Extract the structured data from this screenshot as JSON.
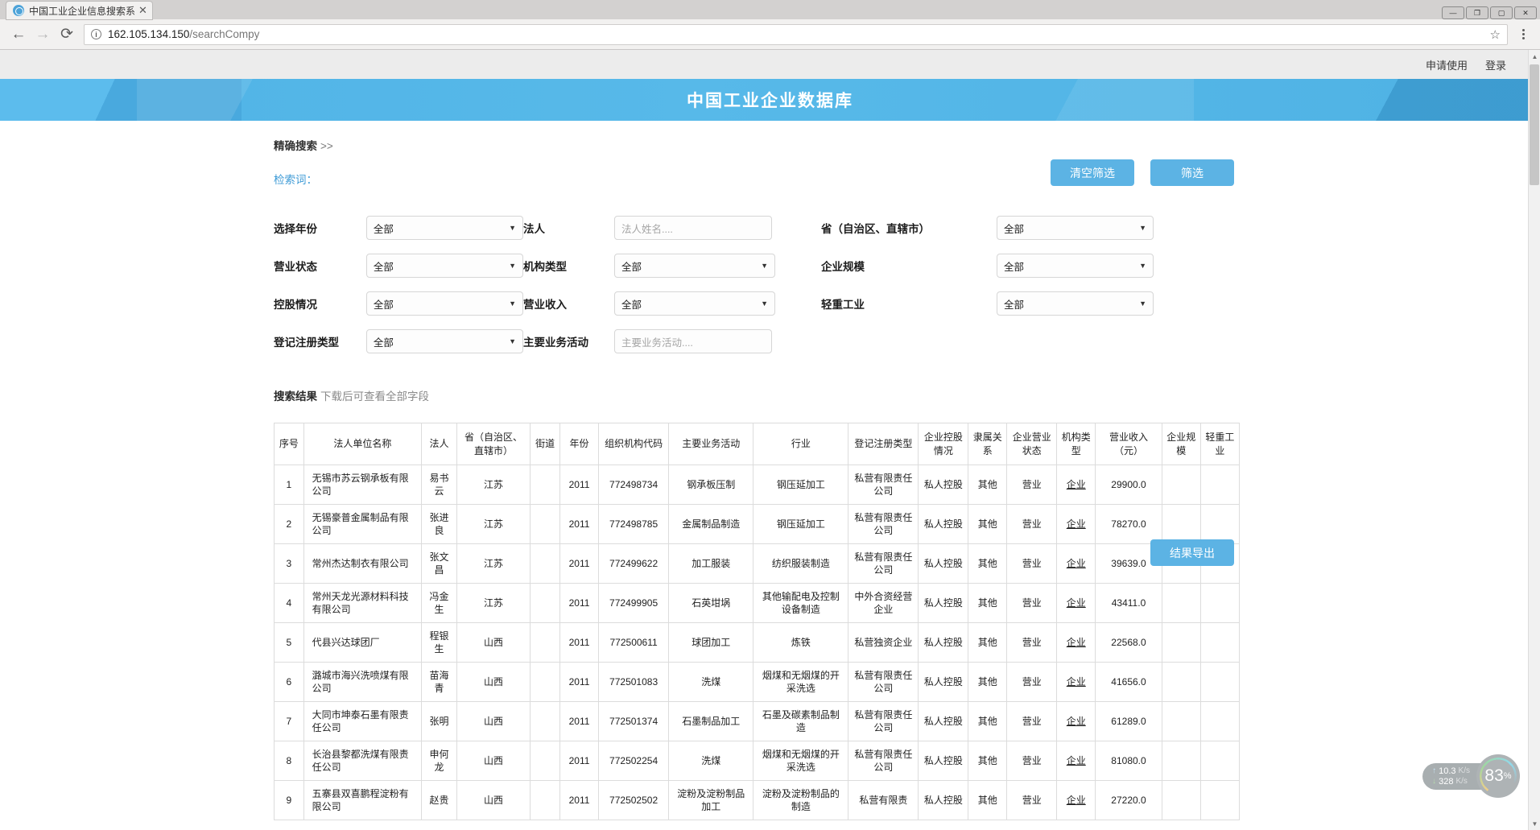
{
  "browser": {
    "tab_title": "中国工业企业信息搜索系",
    "tab_close": "✕",
    "favicon": "globe-icon",
    "back": "←",
    "forward": "→",
    "reload": "⟳",
    "url_host": "162.105.134.150",
    "url_path": "/searchCompy",
    "star": "☆",
    "win_minimize": "—",
    "win_restore": "❐",
    "win_maximize": "▢",
    "win_close": "✕"
  },
  "topbar": {
    "apply": "申请使用",
    "login": "登录"
  },
  "banner": {
    "title": "中国工业企业数据库",
    "bg_color": "#50b3e6"
  },
  "search": {
    "precise_label": "精确搜索",
    "precise_arrows": ">>",
    "keyword_label": "检索词：",
    "clear_button": "清空筛选",
    "filter_button": "筛选",
    "accent_color": "#5cb3e4"
  },
  "filters": {
    "rows": [
      [
        {
          "label": "选择年份",
          "type": "select",
          "value": "全部"
        },
        {
          "label": "法人",
          "type": "text",
          "value": "",
          "placeholder": "法人姓名...."
        },
        {
          "label": "省（自治区、直辖市）",
          "type": "select",
          "value": "全部"
        }
      ],
      [
        {
          "label": "营业状态",
          "type": "select",
          "value": "全部"
        },
        {
          "label": "机构类型",
          "type": "select",
          "value": "全部"
        },
        {
          "label": "企业规模",
          "type": "select",
          "value": "全部"
        }
      ],
      [
        {
          "label": "控股情况",
          "type": "select",
          "value": "全部"
        },
        {
          "label": "营业收入",
          "type": "select",
          "value": "全部"
        },
        {
          "label": "轻重工业",
          "type": "select",
          "value": "全部"
        }
      ],
      [
        {
          "label": "登记注册类型",
          "type": "select",
          "value": "全部"
        },
        {
          "label": "主要业务活动",
          "type": "text",
          "value": "",
          "placeholder": "主要业务活动...."
        }
      ]
    ]
  },
  "results": {
    "title": "搜索结果",
    "hint": "下载后可查看全部字段",
    "export_button": "结果导出",
    "columns": [
      "序号",
      "法人单位名称",
      "法人",
      "省（自治区、直辖市）",
      "街道",
      "年份",
      "组织机构代码",
      "主要业务活动",
      "行业",
      "登记注册类型",
      "企业控股情况",
      "隶属关系",
      "企业营业状态",
      "机构类型",
      "营业收入（元）",
      "企业规模",
      "轻重工业"
    ],
    "rows": [
      {
        "no": "1",
        "name": "无锡市苏云钢承板有限公司",
        "legal": "易书云",
        "province": "江苏",
        "street": "",
        "year": "2011",
        "code": "772498734",
        "activity": "钢承板压制",
        "industry": "钢压延加工",
        "reg_type": "私营有限责任公司",
        "holding": "私人控股",
        "affiliation": "其他",
        "biz_status": "营业",
        "org_type": "企业",
        "revenue": "29900.0",
        "scale": "",
        "lh_industry": ""
      },
      {
        "no": "2",
        "name": "无锡豪普金属制品有限公司",
        "legal": "张进良",
        "province": "江苏",
        "street": "",
        "year": "2011",
        "code": "772498785",
        "activity": "金属制品制造",
        "industry": "钢压延加工",
        "reg_type": "私营有限责任公司",
        "holding": "私人控股",
        "affiliation": "其他",
        "biz_status": "营业",
        "org_type": "企业",
        "revenue": "78270.0",
        "scale": "",
        "lh_industry": ""
      },
      {
        "no": "3",
        "name": "常州杰达制衣有限公司",
        "legal": "张文昌",
        "province": "江苏",
        "street": "",
        "year": "2011",
        "code": "772499622",
        "activity": "加工服装",
        "industry": "纺织服装制造",
        "reg_type": "私营有限责任公司",
        "holding": "私人控股",
        "affiliation": "其他",
        "biz_status": "营业",
        "org_type": "企业",
        "revenue": "39639.0",
        "scale": "",
        "lh_industry": ""
      },
      {
        "no": "4",
        "name": "常州天龙光源材料科技有限公司",
        "legal": "冯金生",
        "province": "江苏",
        "street": "",
        "year": "2011",
        "code": "772499905",
        "activity": "石英坩埚",
        "industry": "其他输配电及控制设备制造",
        "reg_type": "中外合资经营企业",
        "holding": "私人控股",
        "affiliation": "其他",
        "biz_status": "营业",
        "org_type": "企业",
        "revenue": "43411.0",
        "scale": "",
        "lh_industry": ""
      },
      {
        "no": "5",
        "name": "代县兴达球团厂",
        "legal": "程银生",
        "province": "山西",
        "street": "",
        "year": "2011",
        "code": "772500611",
        "activity": "球团加工",
        "industry": "炼铁",
        "reg_type": "私营独资企业",
        "holding": "私人控股",
        "affiliation": "其他",
        "biz_status": "营业",
        "org_type": "企业",
        "revenue": "22568.0",
        "scale": "",
        "lh_industry": ""
      },
      {
        "no": "6",
        "name": "潞城市海兴洗喷煤有限公司",
        "legal": "苗海青",
        "province": "山西",
        "street": "",
        "year": "2011",
        "code": "772501083",
        "activity": "洗煤",
        "industry": "烟煤和无烟煤的开采洗选",
        "reg_type": "私营有限责任公司",
        "holding": "私人控股",
        "affiliation": "其他",
        "biz_status": "营业",
        "org_type": "企业",
        "revenue": "41656.0",
        "scale": "",
        "lh_industry": ""
      },
      {
        "no": "7",
        "name": "大同市坤泰石墨有限责任公司",
        "legal": "张明",
        "province": "山西",
        "street": "",
        "year": "2011",
        "code": "772501374",
        "activity": "石墨制品加工",
        "industry": "石墨及碳素制品制造",
        "reg_type": "私营有限责任公司",
        "holding": "私人控股",
        "affiliation": "其他",
        "biz_status": "营业",
        "org_type": "企业",
        "revenue": "61289.0",
        "scale": "",
        "lh_industry": ""
      },
      {
        "no": "8",
        "name": "长治县黎都洗煤有限责任公司",
        "legal": "申何龙",
        "province": "山西",
        "street": "",
        "year": "2011",
        "code": "772502254",
        "activity": "洗煤",
        "industry": "烟煤和无烟煤的开采洗选",
        "reg_type": "私营有限责任公司",
        "holding": "私人控股",
        "affiliation": "其他",
        "biz_status": "营业",
        "org_type": "企业",
        "revenue": "81080.0",
        "scale": "",
        "lh_industry": ""
      },
      {
        "no": "9",
        "name": "五寨县双喜鹏程淀粉有限公司",
        "legal": "赵贵",
        "province": "山西",
        "street": "",
        "year": "2011",
        "code": "772502502",
        "activity": "淀粉及淀粉制品加工",
        "industry": "淀粉及淀粉制品的制造",
        "reg_type": "私营有限责",
        "holding": "私人控股",
        "affiliation": "其他",
        "biz_status": "营业",
        "org_type": "企业",
        "revenue": "27220.0",
        "scale": "",
        "lh_industry": ""
      }
    ]
  },
  "net_widget": {
    "upload": "10.3",
    "upload_unit": "K/s",
    "download": "328",
    "download_unit": "K/s",
    "percent": "83",
    "percent_sign": "%",
    "up_arrow": "↑",
    "down_arrow": "↓"
  }
}
